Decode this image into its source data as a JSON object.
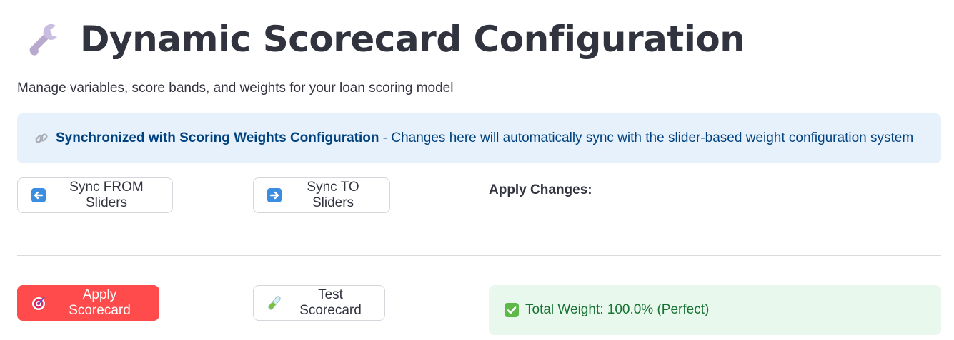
{
  "header": {
    "title": "Dynamic Scorecard Configuration",
    "icon": "wrench-icon",
    "subtitle": "Manage variables, score bands, and weights for your loan scoring model"
  },
  "info": {
    "icon": "link-icon",
    "bold_text": "Synchronized with Scoring Weights Configuration",
    "text": " - Changes here will automatically sync with the slider-based weight configuration system"
  },
  "sync": {
    "from_label": "Sync FROM Sliders",
    "from_icon": "left-arrow-icon",
    "to_label": "Sync TO Sliders",
    "to_icon": "right-arrow-icon",
    "apply_changes_label": "Apply Changes:"
  },
  "actions": {
    "apply_label": "Apply Scorecard",
    "apply_icon": "target-icon",
    "test_label": "Test Scorecard",
    "test_icon": "test-tube-icon"
  },
  "status": {
    "icon": "check-box-icon",
    "text": "Total Weight: 100.0% (Perfect)"
  },
  "colors": {
    "primary": "#ff4b4b",
    "info_bg": "#e7f1fb",
    "info_text": "#004280",
    "success_bg": "#e8f8ec",
    "success_text": "#177233",
    "emoji_blue": "#3b8de0"
  }
}
